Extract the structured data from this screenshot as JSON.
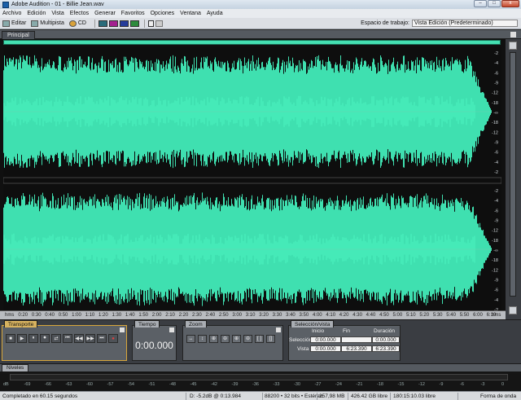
{
  "window": {
    "title": "Adobe Audition - 01 - Billie Jean.wav",
    "min": "–",
    "max": "□",
    "close": "x"
  },
  "menu": [
    "Archivo",
    "Edición",
    "Vista",
    "Efectos",
    "Generar",
    "Favoritos",
    "Opciones",
    "Ventana",
    "Ayuda"
  ],
  "toolbar": {
    "editar": "Editar",
    "multipista": "Multipista",
    "cd": "CD",
    "workspace_label": "Espacio de trabajo:",
    "workspace_value": "Vista Edición (Predeterminado)"
  },
  "main_panel": {
    "tab": "Principal"
  },
  "waveform": {
    "db_scale": [
      "-2",
      "-4",
      "-6",
      "-9",
      "-12",
      "-18",
      "-∞",
      "-18",
      "-12",
      "-9",
      "-6",
      "-4",
      "-2"
    ],
    "waveform_color": "#3fe0b0",
    "fade_out_at": "6:00"
  },
  "ruler": {
    "labels": [
      "hms",
      "0:20",
      "0:30",
      "0:40",
      "0:50",
      "1:00",
      "1:10",
      "1:20",
      "1:30",
      "1:40",
      "1:50",
      "2:00",
      "2:10",
      "2:20",
      "2:30",
      "2:40",
      "2:50",
      "3:00",
      "3:10",
      "3:20",
      "3:30",
      "3:40",
      "3:50",
      "4:00",
      "4:10",
      "4:20",
      "4:30",
      "4:40",
      "4:50",
      "5:00",
      "5:10",
      "5:20",
      "5:30",
      "5:40",
      "5:50",
      "6:00",
      "6:10",
      "hms"
    ]
  },
  "transport": {
    "tab": "Transporte",
    "buttons": [
      "■",
      "▶",
      "⏸",
      "⏺",
      "⇄",
      "⏮",
      "◀◀",
      "▶▶",
      "⏭",
      "●"
    ]
  },
  "time": {
    "tab": "Tiempo",
    "value": "0:00.000"
  },
  "zoom": {
    "tab": "Zoom",
    "buttons": [
      "↔",
      "↕",
      "⊕",
      "⊖",
      "⊕",
      "⊖",
      "[ ]",
      "[]"
    ]
  },
  "selection": {
    "tab": "Selección/vista",
    "headers": [
      "Inicio",
      "Fin",
      "Duración"
    ],
    "rows": [
      {
        "label": "Selección",
        "inicio": "0:00.000",
        "fin": "",
        "duracion": "0:00.000"
      },
      {
        "label": "Vista",
        "inicio": "0:00.000",
        "fin": "6:23.390",
        "duracion": "6:23.390"
      }
    ]
  },
  "levels": {
    "tab": "Niveles",
    "scale": [
      "dB",
      "-69",
      "-66",
      "-63",
      "-60",
      "-57",
      "-54",
      "-51",
      "-48",
      "-45",
      "-42",
      "-39",
      "-36",
      "-33",
      "-30",
      "-27",
      "-24",
      "-21",
      "-18",
      "-15",
      "-12",
      "-9",
      "-6",
      "-3",
      "0"
    ]
  },
  "status": {
    "left": "Completado en 60.15 segundos",
    "peak": "D: -5.2dB @ 0:13.984",
    "format": "88200 • 32 bits • Estéreo",
    "size": "257,98 MB",
    "free": "426.42 GB libre",
    "time_free": "180:15:10.03 libre",
    "view": "Forma de onda"
  }
}
